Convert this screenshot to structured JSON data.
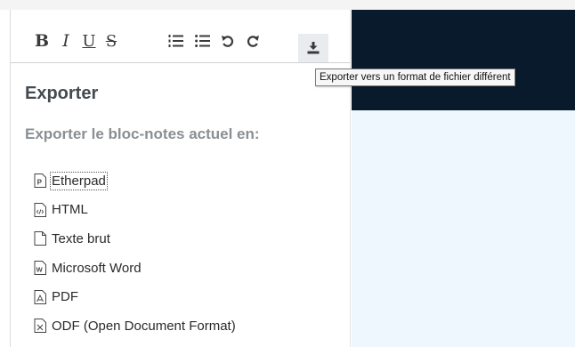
{
  "toolbar": {
    "bold_label": "B",
    "italic_label": "I",
    "underline_label": "U",
    "strike_label": "S",
    "icons": [
      "ordered-list-icon",
      "unordered-list-icon",
      "undo-icon",
      "redo-icon",
      "download-icon"
    ]
  },
  "panel": {
    "title": "Exporter",
    "subtitle": "Exporter le bloc-notes actuel en:"
  },
  "export_options": [
    {
      "label": "Etherpad",
      "icon": "etherpad-file-icon"
    },
    {
      "label": "HTML",
      "icon": "html-file-icon"
    },
    {
      "label": "Texte brut",
      "icon": "text-file-icon"
    },
    {
      "label": "Microsoft Word",
      "icon": "word-file-icon"
    },
    {
      "label": "PDF",
      "icon": "pdf-file-icon"
    },
    {
      "label": "ODF (Open Document Format)",
      "icon": "odf-file-icon"
    }
  ],
  "tooltip": {
    "text": "Exporter vers un format de fichier différent"
  },
  "colors": {
    "dark_header": "#081a2c",
    "right_area": "#eef7fd",
    "title_text": "#444a50",
    "subtitle_text": "#8a8f94"
  }
}
